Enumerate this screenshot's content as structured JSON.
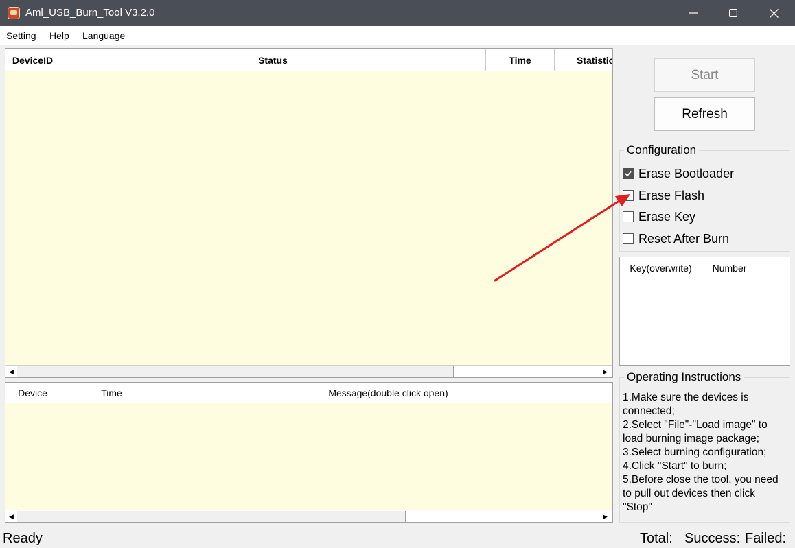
{
  "window": {
    "title": "Aml_USB_Burn_Tool V3.2.0"
  },
  "menu": {
    "items": [
      "Setting",
      "Help",
      "Language"
    ]
  },
  "device_table": {
    "columns": [
      "DeviceID",
      "Status",
      "Time",
      "Statistic"
    ]
  },
  "message_table": {
    "columns": [
      "Device",
      "Time",
      "Message(double click open)"
    ]
  },
  "buttons": {
    "start": "Start",
    "refresh": "Refresh"
  },
  "configuration": {
    "title": "Configuration",
    "options": [
      {
        "label": "Erase Bootloader",
        "checked": true
      },
      {
        "label": "Erase Flash",
        "checked": false
      },
      {
        "label": "Erase Key",
        "checked": false
      },
      {
        "label": "Reset After Burn",
        "checked": false
      }
    ]
  },
  "key_table": {
    "columns": [
      "Key(overwrite)",
      "Number"
    ]
  },
  "instructions": {
    "title": "Operating Instructions",
    "lines": [
      "1.Make sure the devices is connected;",
      "2.Select \"File\"-\"Load image\" to load burning image package;",
      "3.Select burning configuration;",
      "4.Click \"Start\" to burn;",
      "5.Before close the tool, you need to pull out devices then click \"Stop\""
    ]
  },
  "status_bar": {
    "ready": "Ready",
    "total": "Total:",
    "success": "Success:",
    "failed": "Failed:"
  },
  "colors": {
    "titlebar": "#4a4f57",
    "list_bg": "#fffde0",
    "annotation_arrow": "#e02020"
  }
}
